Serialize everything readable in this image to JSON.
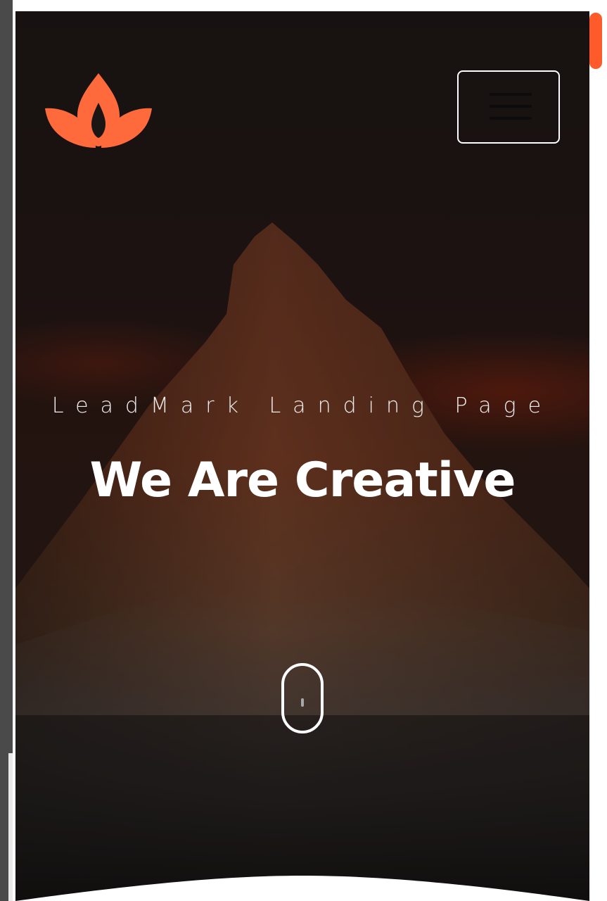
{
  "hero": {
    "subtitle": "LeadMark Landing Page",
    "headline": "We Are Creative"
  },
  "header": {
    "logo_icon": "lotus-icon",
    "menu_icon": "hamburger-menu-icon"
  },
  "scroll_indicator": {
    "icon": "mouse-scroll-icon"
  },
  "colors": {
    "accent": "#ff6a3d",
    "scrollbar": "#ff5a2a",
    "text": "#ffffff",
    "hero_background": "#1b1614"
  }
}
